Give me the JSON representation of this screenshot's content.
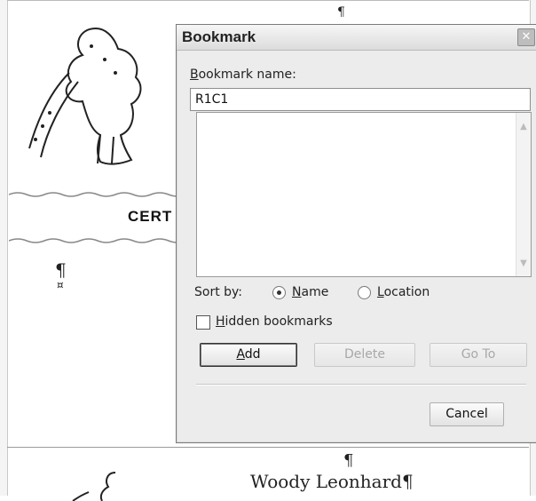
{
  "document": {
    "pilcrow": "¶",
    "cell_marker": "¤",
    "certificate_text": "CERT",
    "name_line": "Woody Leonhard¶"
  },
  "dialog": {
    "title": "Bookmark",
    "close_glyph": "✕",
    "name_label_accel": "B",
    "name_label_rest": "ookmark name:",
    "name_value": "R1C1",
    "sort_by_label": "Sort by:",
    "sort_name_accel": "N",
    "sort_name_rest": "ame",
    "sort_location_accel": "L",
    "sort_location_rest": "ocation",
    "sort_selected": "Name",
    "hidden_accel": "H",
    "hidden_rest": "idden bookmarks",
    "hidden_checked": false,
    "add_accel": "A",
    "add_rest": "dd",
    "delete_label": "Delete",
    "goto_label": "Go To",
    "cancel_label": "Cancel",
    "list_items": []
  }
}
